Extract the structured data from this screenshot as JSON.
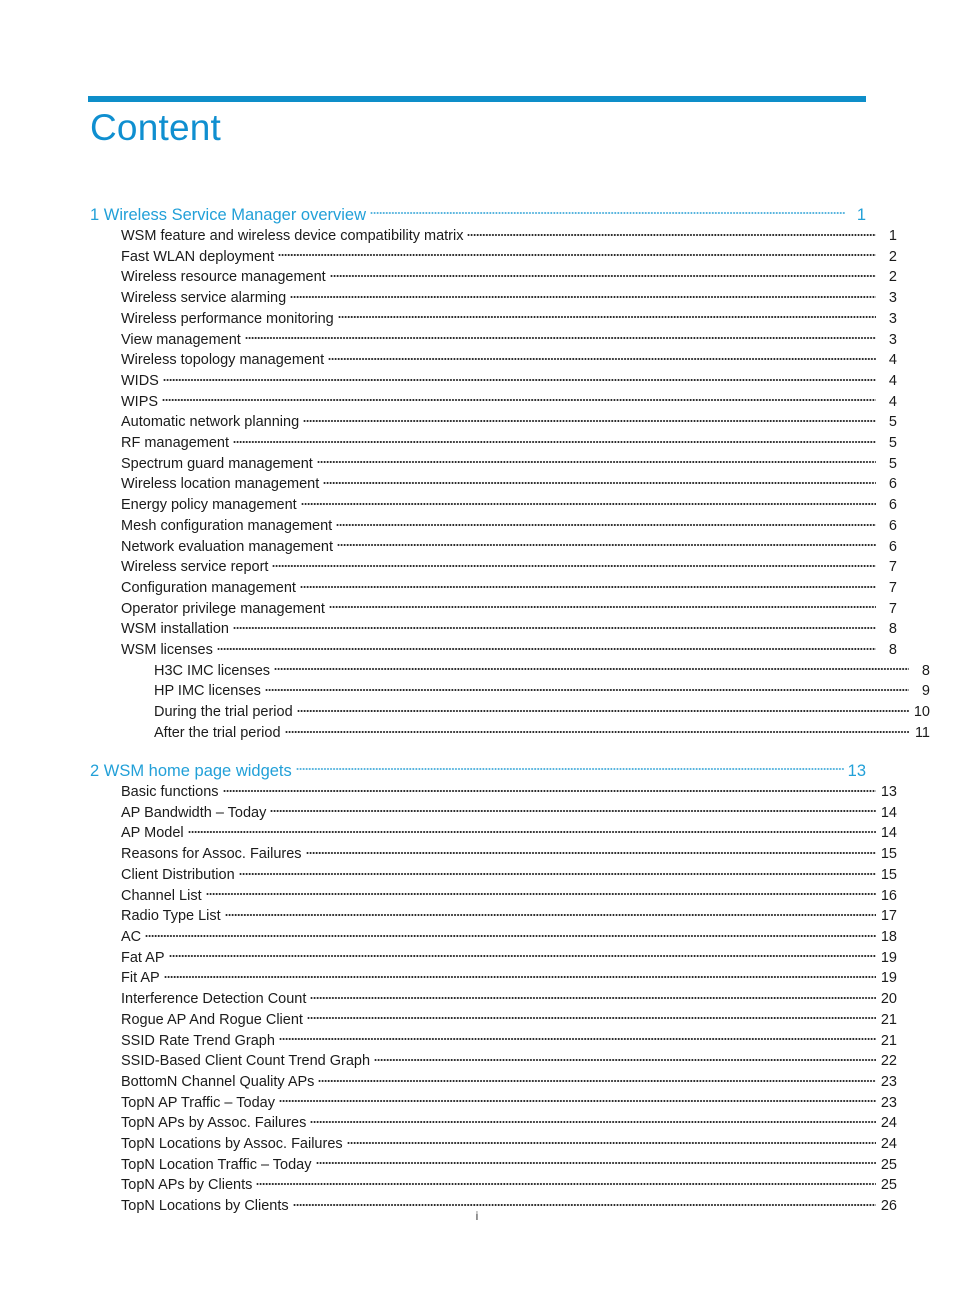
{
  "document": {
    "title": "Content",
    "footer_page_number": "i",
    "accent_color": "#0e8ec9",
    "heading_color": "#22a0d8"
  },
  "toc": {
    "entries": [
      {
        "level": 1,
        "label": "1 Wireless Service Manager overview",
        "page": "1"
      },
      {
        "level": 2,
        "label": "WSM feature and wireless device compatibility matrix",
        "page": "1"
      },
      {
        "level": 2,
        "label": "Fast WLAN deployment",
        "page": "2"
      },
      {
        "level": 2,
        "label": "Wireless resource management",
        "page": "2"
      },
      {
        "level": 2,
        "label": "Wireless service alarming",
        "page": "3"
      },
      {
        "level": 2,
        "label": "Wireless performance monitoring",
        "page": "3"
      },
      {
        "level": 2,
        "label": "View management",
        "page": "3"
      },
      {
        "level": 2,
        "label": "Wireless topology management",
        "page": "4"
      },
      {
        "level": 2,
        "label": "WIDS",
        "page": "4"
      },
      {
        "level": 2,
        "label": "WIPS",
        "page": "4"
      },
      {
        "level": 2,
        "label": "Automatic network planning",
        "page": "5"
      },
      {
        "level": 2,
        "label": "RF management",
        "page": "5"
      },
      {
        "level": 2,
        "label": "Spectrum guard management",
        "page": "5"
      },
      {
        "level": 2,
        "label": "Wireless location management",
        "page": "6"
      },
      {
        "level": 2,
        "label": "Energy policy management",
        "page": "6"
      },
      {
        "level": 2,
        "label": "Mesh configuration management",
        "page": "6"
      },
      {
        "level": 2,
        "label": "Network evaluation management",
        "page": "6"
      },
      {
        "level": 2,
        "label": "Wireless service report",
        "page": "7"
      },
      {
        "level": 2,
        "label": "Configuration management",
        "page": "7"
      },
      {
        "level": 2,
        "label": "Operator privilege management",
        "page": "7"
      },
      {
        "level": 2,
        "label": "WSM installation",
        "page": "8"
      },
      {
        "level": 2,
        "label": "WSM licenses",
        "page": "8"
      },
      {
        "level": 3,
        "label": "H3C IMC licenses",
        "page": "8"
      },
      {
        "level": 3,
        "label": "HP IMC licenses",
        "page": "9"
      },
      {
        "level": 3,
        "label": "During the trial period",
        "page": "10"
      },
      {
        "level": 3,
        "label": "After the trial period",
        "page": "11"
      },
      {
        "level": 1,
        "label": "2 WSM home page widgets",
        "page": "13"
      },
      {
        "level": 2,
        "label": "Basic functions",
        "page": "13"
      },
      {
        "level": 2,
        "label": "AP Bandwidth – Today",
        "page": "14"
      },
      {
        "level": 2,
        "label": "AP Model",
        "page": "14"
      },
      {
        "level": 2,
        "label": "Reasons for Assoc. Failures",
        "page": "15"
      },
      {
        "level": 2,
        "label": "Client Distribution",
        "page": "15"
      },
      {
        "level": 2,
        "label": "Channel List",
        "page": "16"
      },
      {
        "level": 2,
        "label": "Radio Type List",
        "page": "17"
      },
      {
        "level": 2,
        "label": "AC",
        "page": "18"
      },
      {
        "level": 2,
        "label": "Fat AP",
        "page": "19"
      },
      {
        "level": 2,
        "label": "Fit AP",
        "page": "19"
      },
      {
        "level": 2,
        "label": "Interference Detection Count",
        "page": "20"
      },
      {
        "level": 2,
        "label": "Rogue AP And Rogue Client",
        "page": "21"
      },
      {
        "level": 2,
        "label": "SSID Rate Trend Graph",
        "page": "21"
      },
      {
        "level": 2,
        "label": "SSID-Based Client Count Trend Graph",
        "page": "22"
      },
      {
        "level": 2,
        "label": "BottomN Channel Quality APs",
        "page": "23"
      },
      {
        "level": 2,
        "label": "TopN AP Traffic – Today",
        "page": "23"
      },
      {
        "level": 2,
        "label": "TopN APs by Assoc. Failures",
        "page": "24"
      },
      {
        "level": 2,
        "label": "TopN Locations by Assoc. Failures",
        "page": "24"
      },
      {
        "level": 2,
        "label": "TopN Location Traffic – Today",
        "page": "25"
      },
      {
        "level": 2,
        "label": "TopN APs by Clients",
        "page": "25"
      },
      {
        "level": 2,
        "label": "TopN Locations by Clients",
        "page": "26"
      }
    ]
  }
}
